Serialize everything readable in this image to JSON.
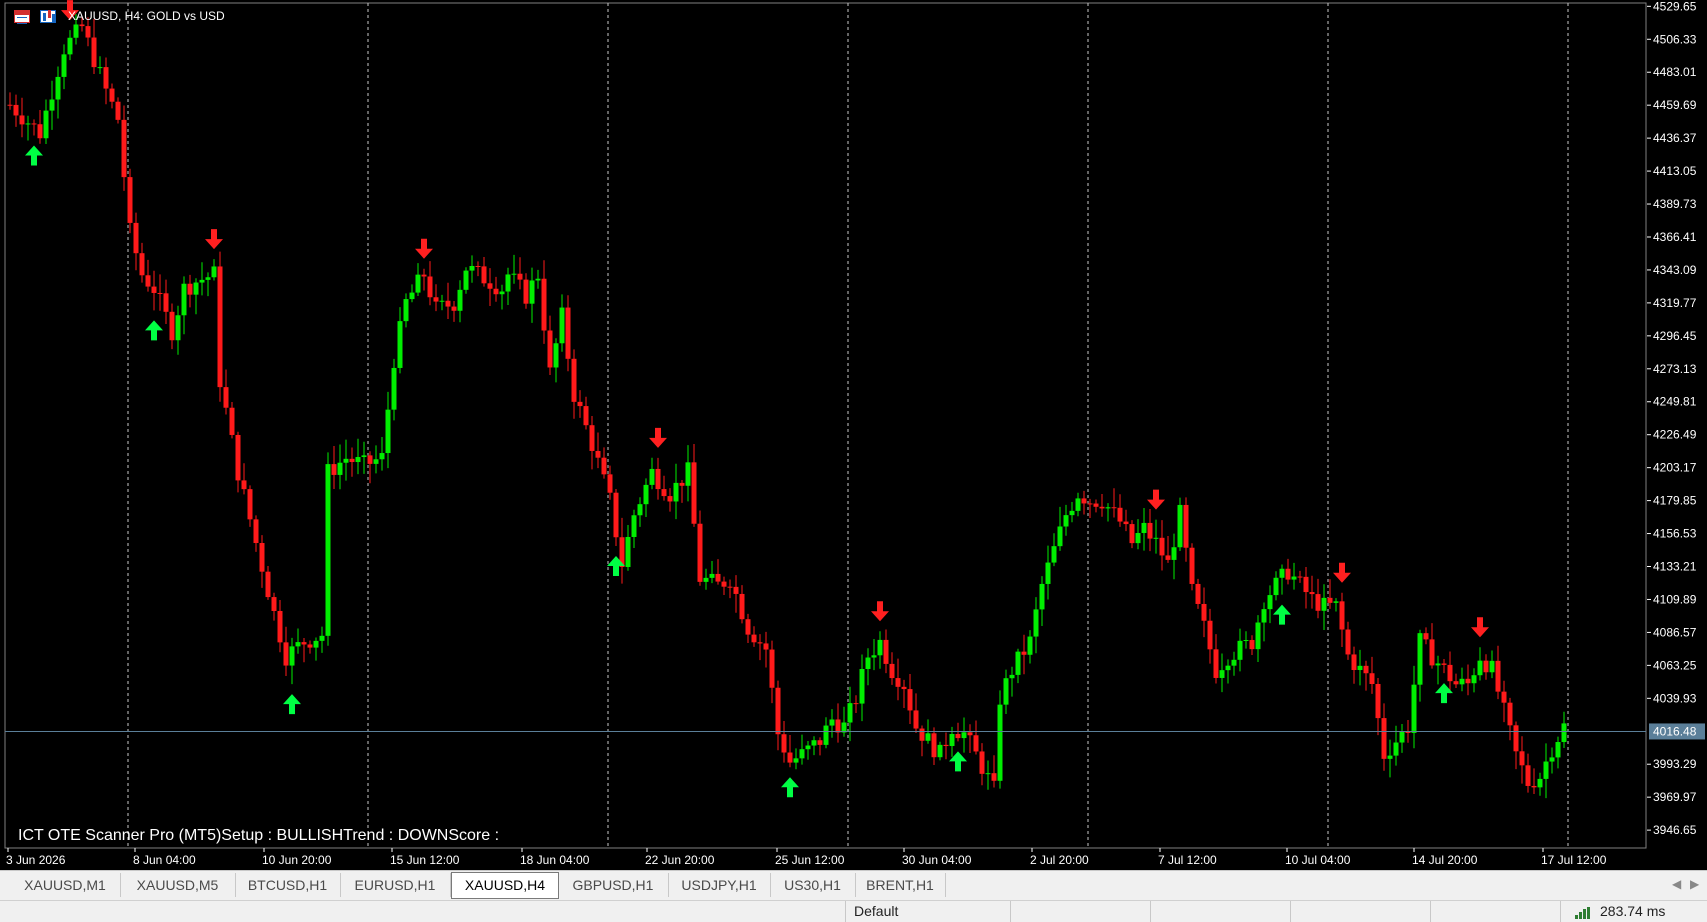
{
  "header": {
    "title": "XAUUSD, H4:  GOLD vs USD",
    "icons": [
      "table-icon",
      "bars-icon"
    ]
  },
  "indicator": {
    "label": "ICT OTE Scanner Pro (MT5)Setup : BULLISHTrend : DOWNScore :"
  },
  "current_price": "4016.48",
  "colors": {
    "background": "#000000",
    "bull": "#00ee00",
    "bear": "#ff1a1a",
    "up_arrow": "#00ff44",
    "down_arrow": "#ff2020",
    "grid": "#c8c8c8",
    "price_line": "#5b7f99",
    "axis_text": "#ffffff"
  },
  "chart_data": {
    "type": "candlestick",
    "symbol": "XAUUSD",
    "timeframe": "H4",
    "title": "XAUUSD, H4:  GOLD vs USD",
    "ylim": [
      3934,
      4532
    ],
    "y_ticks": [
      "4529.65",
      "4506.33",
      "4483.01",
      "4459.69",
      "4436.37",
      "4413.05",
      "4389.73",
      "4366.41",
      "4343.09",
      "4319.77",
      "4296.45",
      "4273.13",
      "4249.81",
      "4226.49",
      "4203.17",
      "4179.85",
      "4156.53",
      "4133.21",
      "4109.89",
      "4086.57",
      "4063.25",
      "4039.93",
      "3993.29",
      "3969.97",
      "3946.65"
    ],
    "x_ticks": [
      "3 Jun 2026",
      "8 Jun 04:00",
      "10 Jun 20:00",
      "15 Jun 12:00",
      "18 Jun 04:00",
      "22 Jun 20:00",
      "25 Jun 12:00",
      "30 Jun 04:00",
      "2 Jul 20:00",
      "7 Jul 12:00",
      "10 Jul 04:00",
      "14 Jul 20:00",
      "17 Jul 12:00"
    ],
    "grid": true,
    "current_price": 4016.48,
    "anchors": [
      [
        0,
        4460
      ],
      [
        5,
        4440
      ],
      [
        9,
        4500
      ],
      [
        12,
        4515
      ],
      [
        16,
        4470
      ],
      [
        18,
        4450
      ],
      [
        20,
        4370
      ],
      [
        22,
        4340
      ],
      [
        24,
        4330
      ],
      [
        27,
        4300
      ],
      [
        29,
        4330
      ],
      [
        31,
        4335
      ],
      [
        34,
        4340
      ],
      [
        35,
        4265
      ],
      [
        38,
        4200
      ],
      [
        41,
        4150
      ],
      [
        44,
        4100
      ],
      [
        46,
        4070
      ],
      [
        49,
        4080
      ],
      [
        52,
        4085
      ],
      [
        53,
        4200
      ],
      [
        56,
        4210
      ],
      [
        59,
        4205
      ],
      [
        62,
        4210
      ],
      [
        64,
        4280
      ],
      [
        66,
        4320
      ],
      [
        69,
        4340
      ],
      [
        71,
        4315
      ],
      [
        74,
        4320
      ],
      [
        76,
        4345
      ],
      [
        78,
        4340
      ],
      [
        82,
        4330
      ],
      [
        83,
        4340
      ],
      [
        86,
        4325
      ],
      [
        88,
        4340
      ],
      [
        90,
        4270
      ],
      [
        92,
        4310
      ],
      [
        94,
        4255
      ],
      [
        97,
        4220
      ],
      [
        100,
        4180
      ],
      [
        102,
        4135
      ],
      [
        104,
        4170
      ],
      [
        107,
        4200
      ],
      [
        110,
        4185
      ],
      [
        113,
        4200
      ],
      [
        115,
        4125
      ],
      [
        118,
        4120
      ],
      [
        120,
        4125
      ],
      [
        123,
        4090
      ],
      [
        126,
        4075
      ],
      [
        128,
        4015
      ],
      [
        130,
        3995
      ],
      [
        132,
        4000
      ],
      [
        135,
        4010
      ],
      [
        137,
        4025
      ],
      [
        139,
        4020
      ],
      [
        141,
        4040
      ],
      [
        143,
        4070
      ],
      [
        145,
        4080
      ],
      [
        147,
        4060
      ],
      [
        149,
        4050
      ],
      [
        151,
        4020
      ],
      [
        153,
        4010
      ],
      [
        155,
        4000
      ],
      [
        157,
        4020
      ],
      [
        159,
        4015
      ],
      [
        161,
        4000
      ],
      [
        164,
        3975
      ],
      [
        165,
        4040
      ],
      [
        167,
        4060
      ],
      [
        170,
        4080
      ],
      [
        172,
        4120
      ],
      [
        174,
        4145
      ],
      [
        176,
        4170
      ],
      [
        178,
        4185
      ],
      [
        180,
        4180
      ],
      [
        182,
        4180
      ],
      [
        185,
        4165
      ],
      [
        187,
        4150
      ],
      [
        189,
        4160
      ],
      [
        191,
        4150
      ],
      [
        193,
        4135
      ],
      [
        195,
        4170
      ],
      [
        197,
        4115
      ],
      [
        199,
        4090
      ],
      [
        201,
        4060
      ],
      [
        203,
        4070
      ],
      [
        205,
        4075
      ],
      [
        207,
        4080
      ],
      [
        209,
        4110
      ],
      [
        211,
        4120
      ],
      [
        213,
        4130
      ],
      [
        215,
        4120
      ],
      [
        217,
        4110
      ],
      [
        219,
        4105
      ],
      [
        221,
        4105
      ],
      [
        223,
        4070
      ],
      [
        225,
        4060
      ],
      [
        227,
        4050
      ],
      [
        229,
        4000
      ],
      [
        231,
        4010
      ],
      [
        233,
        4020
      ],
      [
        235,
        4080
      ],
      [
        237,
        4070
      ],
      [
        239,
        4060
      ],
      [
        241,
        4050
      ],
      [
        243,
        4050
      ],
      [
        245,
        4070
      ],
      [
        247,
        4060
      ],
      [
        249,
        4030
      ],
      [
        251,
        4000
      ],
      [
        253,
        3980
      ],
      [
        255,
        3985
      ],
      [
        257,
        4005
      ],
      [
        259,
        4020
      ]
    ],
    "signals": {
      "up": [
        4,
        24,
        47,
        101,
        130,
        158,
        212,
        239
      ],
      "down": [
        10,
        34,
        69,
        108,
        145,
        191,
        222,
        245
      ]
    }
  },
  "tabs": [
    {
      "label": "XAUUSD,M1",
      "active": false
    },
    {
      "label": "XAUUSD,M5",
      "active": false
    },
    {
      "label": "BTCUSD,H1",
      "active": false
    },
    {
      "label": "EURUSD,H1",
      "active": false
    },
    {
      "label": "XAUUSD,H4",
      "active": true
    },
    {
      "label": "GBPUSD,H1",
      "active": false
    },
    {
      "label": "USDJPY,H1",
      "active": false
    },
    {
      "label": "US30,H1",
      "active": false
    },
    {
      "label": "BRENT,H1",
      "active": false
    }
  ],
  "status": {
    "profile": "Default",
    "ping": "283.74 ms"
  }
}
